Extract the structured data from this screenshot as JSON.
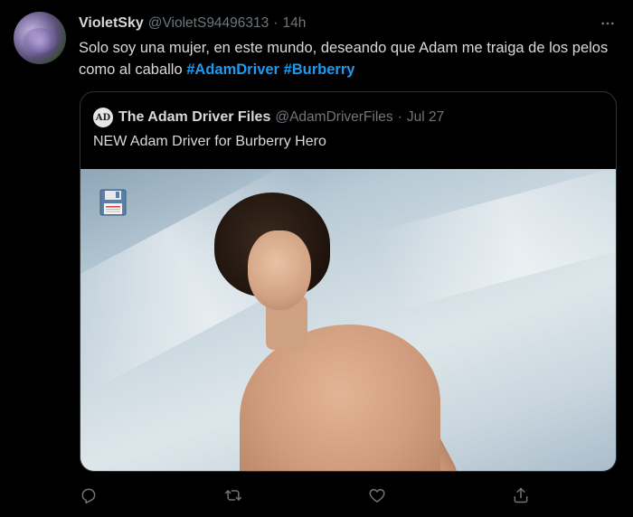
{
  "tweet": {
    "display_name": "VioletSky",
    "handle": "@VioletS94496313",
    "separator": "·",
    "time": "14h",
    "text": "Solo soy una mujer, en este mundo, deseando que Adam me traiga de los pelos como al caballo",
    "hashtags": [
      "#AdamDriver",
      "#Burberry"
    ]
  },
  "quote": {
    "avatar_initials": "AD",
    "display_name": "The Adam Driver Files",
    "handle": "@AdamDriverFiles",
    "separator": "·",
    "date": "Jul 27",
    "text": "NEW Adam Driver for Burberry Hero"
  },
  "icons": {
    "more": "more-options-icon",
    "reply": "reply-icon",
    "retweet": "retweet-icon",
    "like": "like-icon",
    "share": "share-icon",
    "floppy": "floppy-disk-icon"
  },
  "colors": {
    "background": "#000000",
    "text": "#d9d9d9",
    "secondary": "#6e767d",
    "accent": "#1d9bf0",
    "border": "#2f3336"
  }
}
